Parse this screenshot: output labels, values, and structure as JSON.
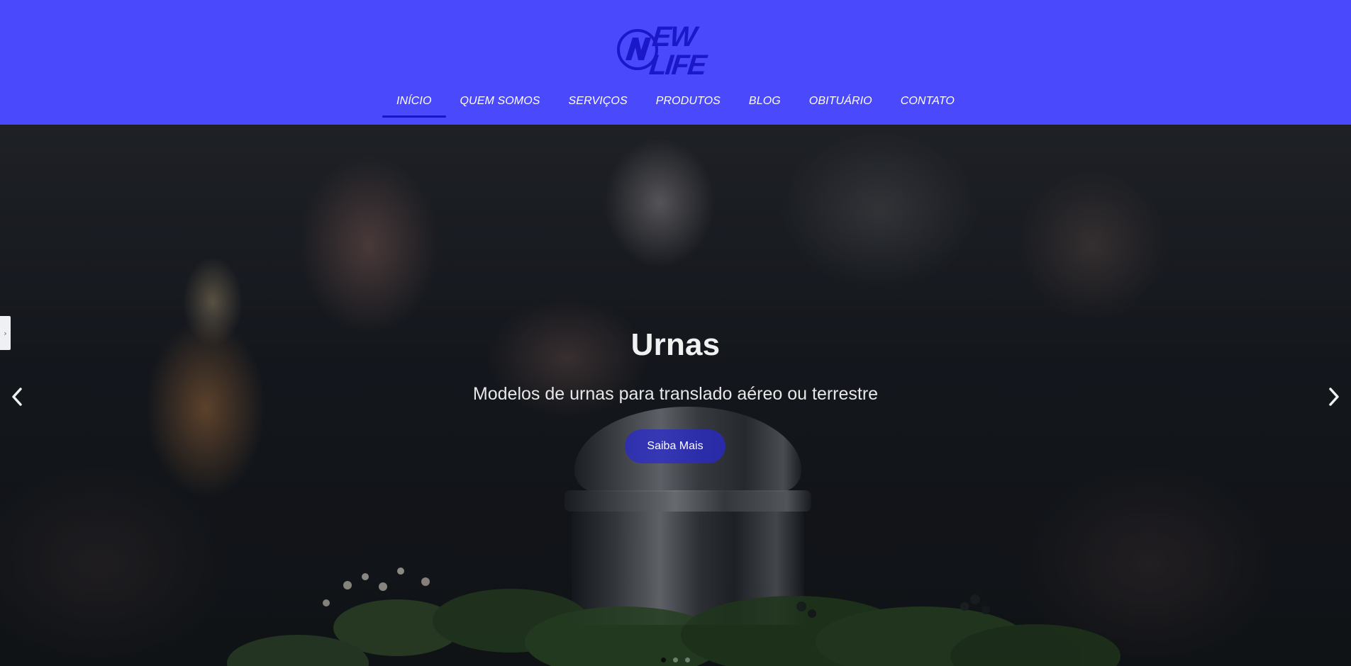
{
  "brand": {
    "logo_text": "EW LIFE",
    "logo_letter": "N",
    "logo_color": "#1a18c8",
    "header_bg": "#4a4afc"
  },
  "nav": {
    "items": [
      {
        "label": "INÍCIO",
        "active": true
      },
      {
        "label": "QUEM SOMOS",
        "active": false
      },
      {
        "label": "SERVIÇOS",
        "active": false
      },
      {
        "label": "PRODUTOS",
        "active": false
      },
      {
        "label": "BLOG",
        "active": false
      },
      {
        "label": "OBITUÁRIO",
        "active": false
      },
      {
        "label": "CONTATO",
        "active": false
      }
    ],
    "active_underline_color": "#1515c9"
  },
  "hero": {
    "title": "Urnas",
    "subtitle": "Modelos de urnas para translado aéreo ou terrestre",
    "button_label": "Saiba Mais",
    "button_color": "#2828d2",
    "prev_icon": "chevron-left-icon",
    "next_icon": "chevron-right-icon"
  },
  "side_tab": {
    "glyph": "›"
  },
  "carousel": {
    "slide_count": 3,
    "active_index": 0
  }
}
